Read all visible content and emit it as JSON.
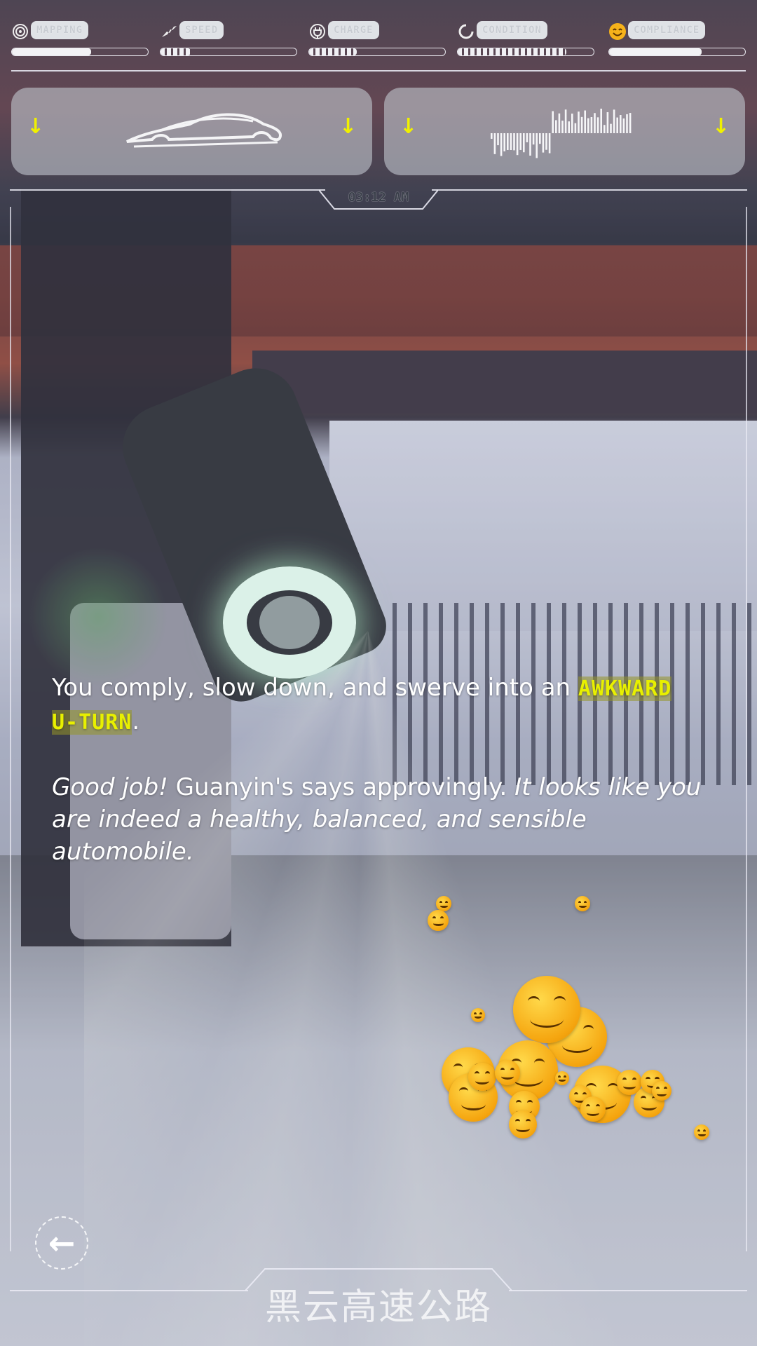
{
  "meters": [
    {
      "id": "mapping",
      "label": "MAPPING",
      "icon": "radar-icon",
      "level": 0.58,
      "segmented": false
    },
    {
      "id": "speed",
      "label": "SPEED",
      "icon": "runner-icon",
      "level": 0.22,
      "segmented": true
    },
    {
      "id": "charge",
      "label": "CHARGE",
      "icon": "plug-icon",
      "level": 0.35,
      "segmented": true
    },
    {
      "id": "condition",
      "label": "CONDITION",
      "icon": "spinner-icon",
      "level": 0.8,
      "segmented": true
    },
    {
      "id": "compliance",
      "label": "COMPLIANCE",
      "icon": "smiley-icon",
      "level": 0.68,
      "segmented": false
    }
  ],
  "panels": {
    "left": {
      "icon": "car-silhouette-icon",
      "arrow_icon": "down-arrow-icon"
    },
    "right": {
      "icon": "audio-waveform-icon",
      "arrow_icon": "down-arrow-icon"
    }
  },
  "clock": {
    "time": "03:12 AM"
  },
  "story": {
    "line1_before": "You comply, slow down, and swerve into an ",
    "highlight": "AWKWARD U-TURN",
    "line1_after": ".",
    "p2_italic1": "Good job!",
    "p2_normal": " Guanyin's says approvingly. ",
    "p2_italic2": "It looks like you are indeed a healthy, balanced, and sensible automobile."
  },
  "footer": {
    "location": "黑云高速公路",
    "back_icon": "back-arrow-icon"
  },
  "colors": {
    "accent_yellow": "#e8f000",
    "panel_bg": "#bec4cc"
  }
}
